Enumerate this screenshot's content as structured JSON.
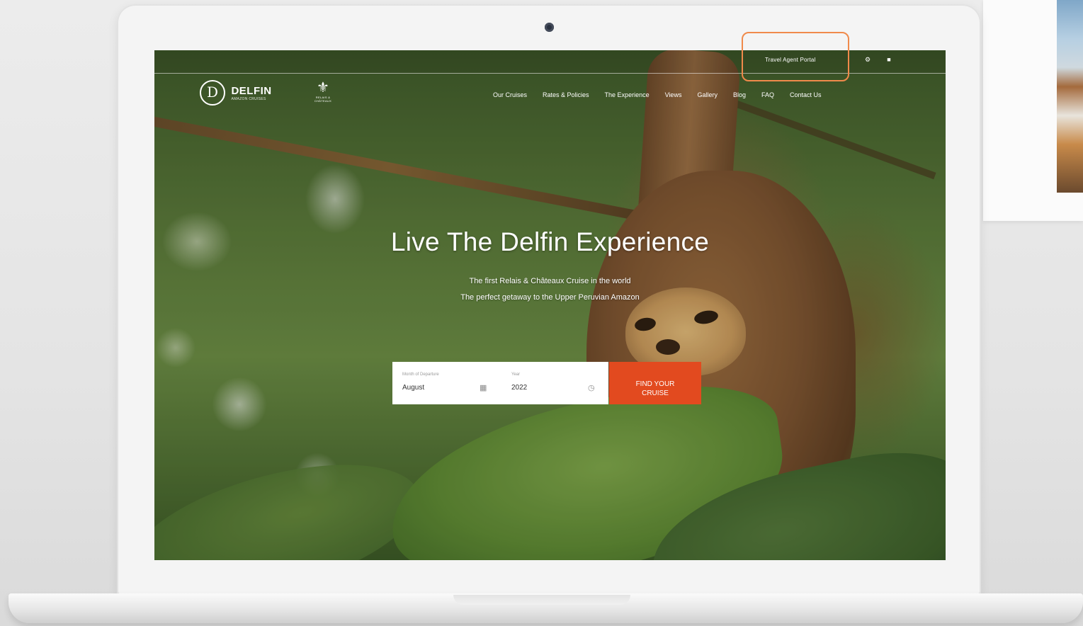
{
  "top_bar": {
    "agent_portal_label": "Travel Agent Portal",
    "icons": [
      "gear-icon",
      "user-icon"
    ]
  },
  "header": {
    "logo_mark": "D",
    "logo_name": "DELFIN",
    "logo_subtitle": "AMAZON CRUISES",
    "crest_glyph": "⚜",
    "crest_text": "RELAIS & CHÂTEAUX",
    "nav": [
      "Our Cruises",
      "Rates & Policies",
      "The Experience",
      "Views",
      "Gallery",
      "Blog",
      "FAQ",
      "Contact Us"
    ]
  },
  "hero": {
    "title": "Live The Delfin Experience",
    "line1": "The first Relais & Châteaux Cruise in the world",
    "line2": "The perfect getaway to the Upper Peruvian Amazon"
  },
  "search": {
    "month_label": "Month of Departure",
    "month_value": "August",
    "year_label": "Year",
    "year_value": "2022",
    "button_line1": "FIND YOUR",
    "button_line2": "CRUISE"
  },
  "colors": {
    "accent": "#e24a1f",
    "highlight": "#f08a4b"
  }
}
